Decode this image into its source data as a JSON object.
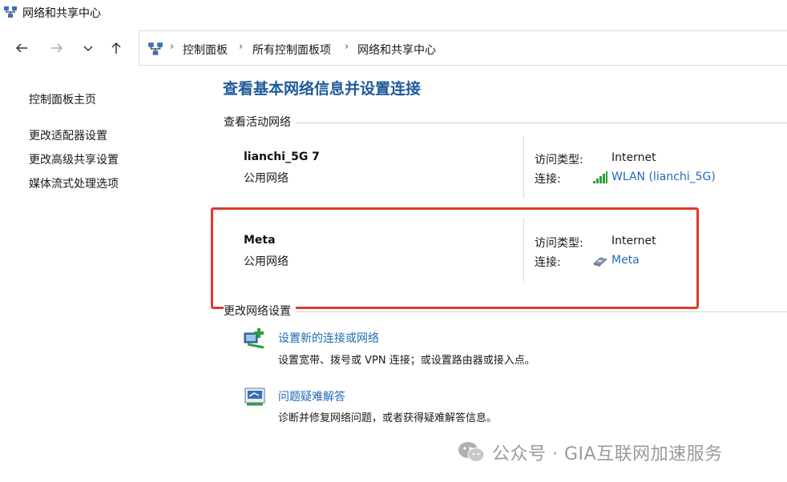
{
  "window": {
    "title": "网络和共享中心"
  },
  "address": {
    "crumbs": [
      "控制面板",
      "所有控制面板项",
      "网络和共享中心"
    ],
    "separator": "›"
  },
  "sidebar": {
    "items": [
      {
        "label": "控制面板主页"
      },
      {
        "label": "更改适配器设置"
      },
      {
        "label": "更改高级共享设置"
      },
      {
        "label": "媒体流式处理选项"
      }
    ]
  },
  "main": {
    "title": "查看基本网络信息并设置连接",
    "active_section": "查看活动网络",
    "networks": [
      {
        "name": "lianchi_5G 7",
        "category": "公用网络",
        "access_label": "访问类型:",
        "access_value": "Internet",
        "conn_label": "连接:",
        "conn_value": "WLAN (lianchi_5G)",
        "conn_icon": "wifi-signal-icon"
      },
      {
        "name": "Meta",
        "category": "公用网络",
        "access_label": "访问类型:",
        "access_value": "Internet",
        "conn_label": "连接:",
        "conn_value": "Meta",
        "conn_icon": "ethernet-adapter-icon"
      }
    ],
    "change_section": "更改网络设置",
    "tasks": [
      {
        "link": "设置新的连接或网络",
        "desc": "设置宽带、拨号或 VPN 连接；或设置路由器或接入点。",
        "icon": "new-connection-icon"
      },
      {
        "link": "问题疑难解答",
        "desc": "诊断并修复网络问题，或者获得疑难解答信息。",
        "icon": "troubleshoot-icon"
      }
    ]
  },
  "watermark": {
    "text": "公众号 · GIA互联网加速服务"
  },
  "colors": {
    "link": "#1e6bb8",
    "title": "#1e5a99",
    "highlight": "#e03a2f"
  }
}
